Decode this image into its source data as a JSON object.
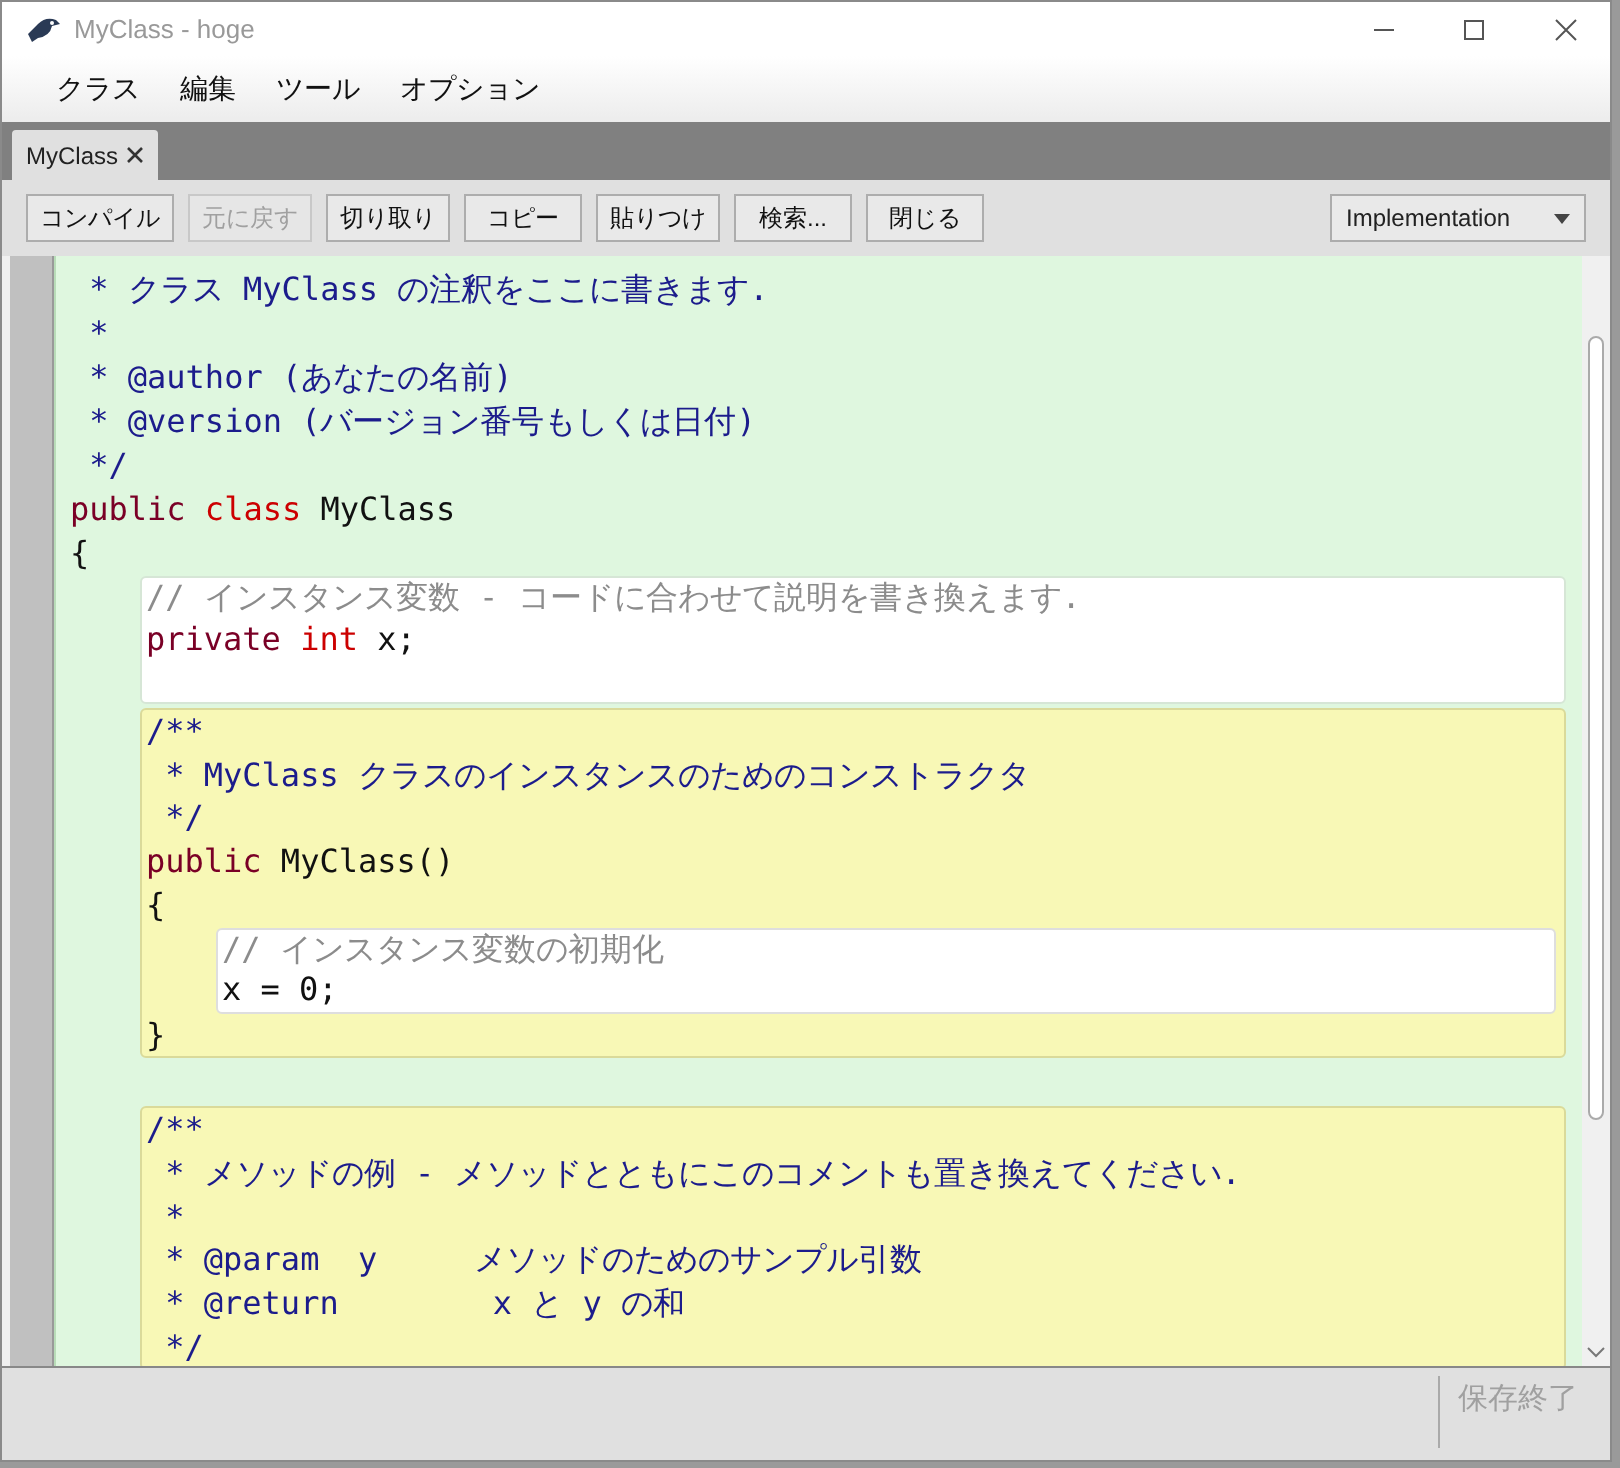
{
  "window": {
    "title": "MyClass - hoge"
  },
  "menu": [
    "クラス",
    "編集",
    "ツール",
    "オプション"
  ],
  "tabs": [
    {
      "label": "MyClass",
      "selected": true
    }
  ],
  "toolbar": {
    "buttons": [
      {
        "label": "コンパイル",
        "disabled": false
      },
      {
        "label": "元に戻す",
        "disabled": true
      },
      {
        "label": "切り取り",
        "disabled": false
      },
      {
        "label": "コピー",
        "disabled": false
      },
      {
        "label": "貼りつけ",
        "disabled": false
      },
      {
        "label": "検索...",
        "disabled": false
      },
      {
        "label": "閉じる",
        "disabled": false
      }
    ],
    "view_select": "Implementation"
  },
  "editor": {
    "kind": "class",
    "items": [
      {
        "kind": "line",
        "tokens": [
          {
            "kind": "javadoc",
            "text": " * クラス MyClass の注釈をここに書きます."
          }
        ]
      },
      {
        "kind": "line",
        "tokens": [
          {
            "kind": "javadoc",
            "text": " *"
          }
        ]
      },
      {
        "kind": "line",
        "tokens": [
          {
            "kind": "javadoc",
            "text": " * @author (あなたの名前)"
          }
        ]
      },
      {
        "kind": "line",
        "tokens": [
          {
            "kind": "javadoc",
            "text": " * @version (バージョン番号もしくは日付)"
          }
        ]
      },
      {
        "kind": "line",
        "tokens": [
          {
            "kind": "javadoc",
            "text": " */"
          }
        ]
      },
      {
        "kind": "line",
        "tokens": [
          {
            "kind": "keyword",
            "text": "public"
          },
          {
            "kind": "type",
            "text": " class"
          },
          {
            "kind": "plain",
            "text": " MyClass"
          }
        ]
      },
      {
        "kind": "line",
        "tokens": [
          {
            "kind": "plain",
            "text": "{"
          }
        ]
      },
      {
        "kind": "field",
        "items": [
          {
            "kind": "line",
            "tokens": [
              {
                "kind": "comment",
                "text": "// インスタンス変数 - コードに合わせて説明を書き換えます."
              }
            ]
          },
          {
            "kind": "line",
            "tokens": [
              {
                "kind": "keyword",
                "text": "private"
              },
              {
                "kind": "type",
                "text": " int"
              },
              {
                "kind": "plain",
                "text": " x;"
              }
            ]
          },
          {
            "kind": "blank"
          }
        ]
      },
      {
        "kind": "method",
        "items": [
          {
            "kind": "line",
            "tokens": [
              {
                "kind": "javadoc",
                "text": "/**"
              }
            ]
          },
          {
            "kind": "line",
            "tokens": [
              {
                "kind": "javadoc",
                "text": " * MyClass クラスのインスタンスのためのコンストラクタ"
              }
            ]
          },
          {
            "kind": "line",
            "tokens": [
              {
                "kind": "javadoc",
                "text": " */"
              }
            ]
          },
          {
            "kind": "line",
            "tokens": [
              {
                "kind": "keyword",
                "text": "public"
              },
              {
                "kind": "plain",
                "text": " MyClass()"
              }
            ]
          },
          {
            "kind": "line",
            "tokens": [
              {
                "kind": "plain",
                "text": "{"
              }
            ]
          },
          {
            "kind": "body",
            "items": [
              {
                "kind": "line",
                "tokens": [
                  {
                    "kind": "comment",
                    "text": "// インスタンス変数の初期化"
                  }
                ]
              },
              {
                "kind": "line",
                "tokens": [
                  {
                    "kind": "plain",
                    "text": "x = 0;"
                  }
                ]
              }
            ]
          },
          {
            "kind": "line",
            "tokens": [
              {
                "kind": "plain",
                "text": "}"
              }
            ]
          }
        ]
      },
      {
        "kind": "blank"
      },
      {
        "kind": "method",
        "items": [
          {
            "kind": "line",
            "tokens": [
              {
                "kind": "javadoc",
                "text": "/**"
              }
            ]
          },
          {
            "kind": "line",
            "tokens": [
              {
                "kind": "javadoc",
                "text": " * メソッドの例 - メソッドとともにこのコメントも置き換えてください."
              }
            ]
          },
          {
            "kind": "line",
            "tokens": [
              {
                "kind": "javadoc",
                "text": " *"
              }
            ]
          },
          {
            "kind": "line",
            "tokens": [
              {
                "kind": "javadoc",
                "text": " * @param  y     メソッドのためのサンプル引数"
              }
            ]
          },
          {
            "kind": "line",
            "tokens": [
              {
                "kind": "javadoc",
                "text": " * @return        x と y の和"
              }
            ]
          },
          {
            "kind": "line",
            "tokens": [
              {
                "kind": "javadoc",
                "text": " */"
              }
            ]
          }
        ]
      }
    ]
  },
  "status_bar": {
    "button": {
      "label": "保存終了",
      "disabled": true
    }
  }
}
